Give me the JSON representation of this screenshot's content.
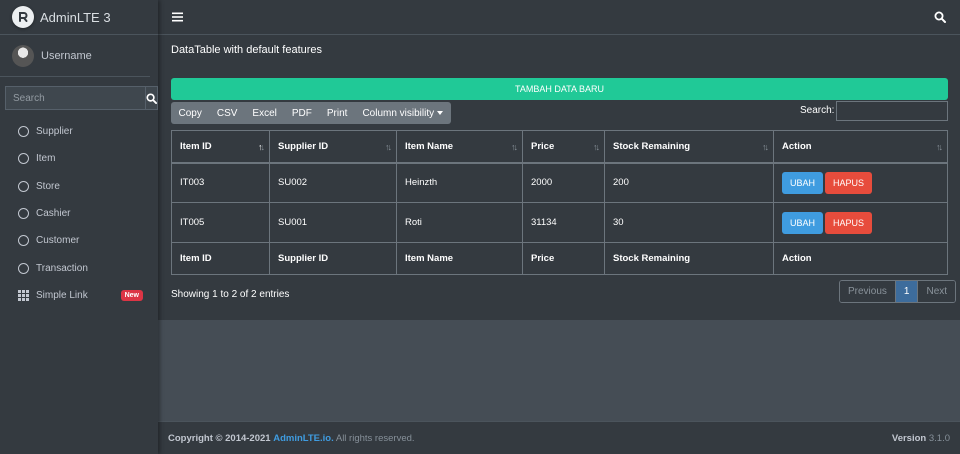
{
  "brand": {
    "title": "AdminLTE 3"
  },
  "user": {
    "name": "Username"
  },
  "sidebar_search": {
    "placeholder": "Search"
  },
  "nav": [
    {
      "label": "Supplier"
    },
    {
      "label": "Item"
    },
    {
      "label": "Store"
    },
    {
      "label": "Cashier"
    },
    {
      "label": "Customer"
    },
    {
      "label": "Transaction"
    },
    {
      "label": "Simple Link",
      "badge": "New"
    }
  ],
  "card": {
    "title": "DataTable with default features"
  },
  "add_button": "TAMBAH DATA BARU",
  "export_buttons": [
    "Copy",
    "CSV",
    "Excel",
    "PDF",
    "Print",
    "Column visibility"
  ],
  "table_search_label": "Search:",
  "table": {
    "headers": [
      "Item ID",
      "Supplier ID",
      "Item Name",
      "Price",
      "Stock Remaining",
      "Action"
    ],
    "rows": [
      [
        "IT003",
        "SU002",
        "Heinzth",
        "2000",
        "200"
      ],
      [
        "IT005",
        "SU001",
        "Roti",
        "31134",
        "30"
      ]
    ],
    "edit_label": "UBAH",
    "delete_label": "HAPUS"
  },
  "info": "Showing 1 to 2 of 2 entries",
  "pagination": {
    "prev": "Previous",
    "page": "1",
    "next": "Next"
  },
  "footer": {
    "copyright": "Copyright © 2014-2021",
    "link": "AdminLTE.io.",
    "rights": "All rights reserved.",
    "version_label": "Version",
    "version": "3.1.0"
  },
  "colors": {
    "accent": "#20c997",
    "edit": "#3f9ce0",
    "delete": "#e74c3c",
    "badge": "#dc3545",
    "bg": "#343a40"
  }
}
